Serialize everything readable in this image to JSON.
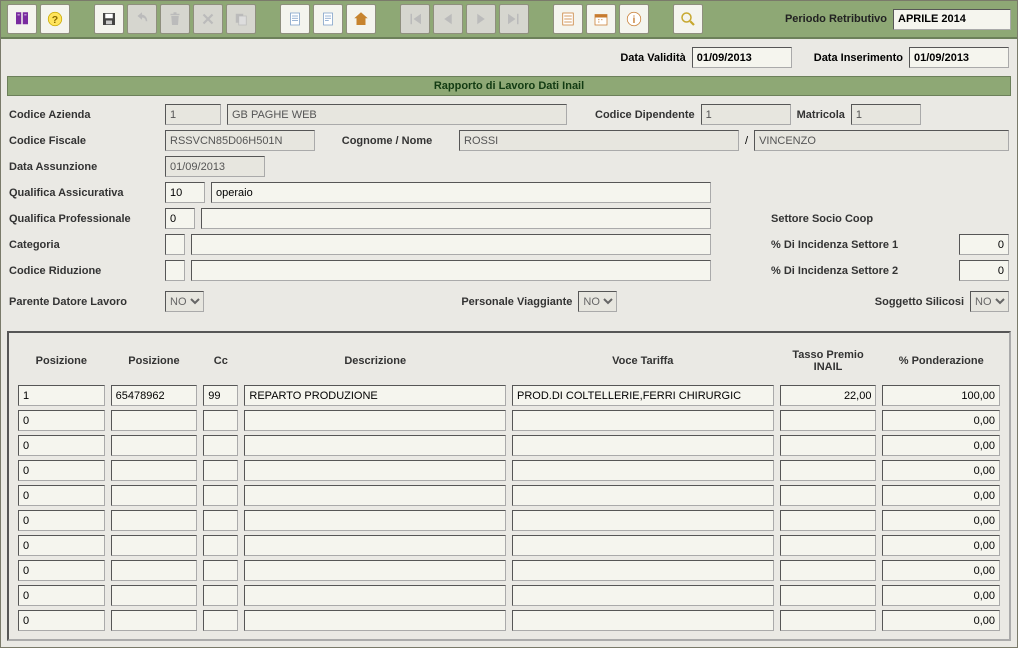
{
  "toolbar": {
    "periodo_label": "Periodo Retributivo",
    "periodo_value": "APRILE 2014",
    "icons": [
      {
        "name": "book-icon",
        "alt": "manual",
        "fill": "#7a2ca0"
      },
      {
        "name": "help-icon",
        "alt": "help",
        "fill": "#e6c100"
      },
      {
        "name": "save-icon",
        "alt": "save",
        "fill": "#333",
        "spacer_before": true
      },
      {
        "name": "undo-icon",
        "alt": "undo",
        "fill": "#999",
        "disabled": true
      },
      {
        "name": "trash-icon",
        "alt": "delete",
        "fill": "#999",
        "disabled": true
      },
      {
        "name": "cancel-icon",
        "alt": "cancel",
        "fill": "#999",
        "disabled": true
      },
      {
        "name": "copy-icon",
        "alt": "copy",
        "fill": "#999",
        "disabled": true
      },
      {
        "name": "doc-icon",
        "alt": "document",
        "fill": "#7a9cc6",
        "spacer_before": true
      },
      {
        "name": "doc2-icon",
        "alt": "document",
        "fill": "#7a9cc6"
      },
      {
        "name": "home-icon",
        "alt": "home",
        "fill": "#c7842f"
      },
      {
        "name": "first-icon",
        "alt": "first",
        "fill": "#999",
        "disabled": true,
        "spacer_before": true
      },
      {
        "name": "prev-icon",
        "alt": "prev",
        "fill": "#999",
        "disabled": true
      },
      {
        "name": "next-icon",
        "alt": "next",
        "fill": "#999",
        "disabled": true
      },
      {
        "name": "last-icon",
        "alt": "last",
        "fill": "#999",
        "disabled": true
      },
      {
        "name": "list-icon",
        "alt": "list",
        "fill": "#c77b2f",
        "spacer_before": true
      },
      {
        "name": "calendar-icon",
        "alt": "calendar",
        "fill": "#c77b2f"
      },
      {
        "name": "info-icon",
        "alt": "info",
        "fill": "#c77b2f"
      },
      {
        "name": "search-icon",
        "alt": "search",
        "fill": "#c7a82f",
        "spacer_before": true
      }
    ]
  },
  "validity": {
    "data_validita_label": "Data Validità",
    "data_validita": "01/09/2013",
    "data_inserimento_label": "Data Inserimento",
    "data_inserimento": "01/09/2013"
  },
  "section": {
    "title": "Rapporto di Lavoro Dati Inail"
  },
  "header": {
    "codice_azienda_label": "Codice Azienda",
    "codice_azienda": "1",
    "azienda_desc": "GB PAGHE WEB",
    "codice_dipendente_label": "Codice Dipendente",
    "codice_dipendente": "1",
    "matricola_label": "Matricola",
    "matricola": "1",
    "codice_fiscale_label": "Codice Fiscale",
    "codice_fiscale": "RSSVCN85D06H501N",
    "cognome_nome_label": "Cognome / Nome",
    "cognome": "ROSSI",
    "nome": "VINCENZO",
    "slash": "/",
    "data_assunzione_label": "Data Assunzione",
    "data_assunzione": "01/09/2013",
    "qual_assic_label": "Qualifica Assicurativa",
    "qual_assic_code": "10",
    "qual_assic_desc": "operaio",
    "qual_prof_label": "Qualifica Professionale",
    "qual_prof_code": "0",
    "qual_prof_desc": "",
    "settore_coop_label": "Settore Socio Coop",
    "categoria_label": "Categoria",
    "categoria_code": "",
    "categoria_desc": "",
    "incidenza1_label": "% Di Incidenza Settore 1",
    "incidenza1": "0",
    "codice_riduzione_label": "Codice Riduzione",
    "codice_riduzione_code": "",
    "codice_riduzione_desc": "",
    "incidenza2_label": "% Di Incidenza Settore 2",
    "incidenza2": "0",
    "parente_label": "Parente Datore Lavoro",
    "parente_value": "NO",
    "viaggiante_label": "Personale Viaggiante",
    "viaggiante_value": "NO",
    "silicosi_label": "Soggetto Silicosi",
    "silicosi_value": "NO"
  },
  "grid": {
    "headers": {
      "pos1": "Posizione",
      "pos2": "Posizione",
      "cc": "Cc",
      "desc": "Descrizione",
      "voce": "Voce Tariffa",
      "tasso": "Tasso Premio INAIL",
      "pond": "% Ponderazione"
    },
    "rows": [
      {
        "pos1": "1",
        "pos2": "65478962",
        "cc": "99",
        "desc": "REPARTO PRODUZIONE",
        "voce": "PROD.DI COLTELLERIE,FERRI CHIRURGIC",
        "tasso": "22,00",
        "pond": "100,00"
      },
      {
        "pos1": "0",
        "pos2": "",
        "cc": "",
        "desc": "",
        "voce": "",
        "tasso": "",
        "pond": "0,00"
      },
      {
        "pos1": "0",
        "pos2": "",
        "cc": "",
        "desc": "",
        "voce": "",
        "tasso": "",
        "pond": "0,00"
      },
      {
        "pos1": "0",
        "pos2": "",
        "cc": "",
        "desc": "",
        "voce": "",
        "tasso": "",
        "pond": "0,00"
      },
      {
        "pos1": "0",
        "pos2": "",
        "cc": "",
        "desc": "",
        "voce": "",
        "tasso": "",
        "pond": "0,00"
      },
      {
        "pos1": "0",
        "pos2": "",
        "cc": "",
        "desc": "",
        "voce": "",
        "tasso": "",
        "pond": "0,00"
      },
      {
        "pos1": "0",
        "pos2": "",
        "cc": "",
        "desc": "",
        "voce": "",
        "tasso": "",
        "pond": "0,00"
      },
      {
        "pos1": "0",
        "pos2": "",
        "cc": "",
        "desc": "",
        "voce": "",
        "tasso": "",
        "pond": "0,00"
      },
      {
        "pos1": "0",
        "pos2": "",
        "cc": "",
        "desc": "",
        "voce": "",
        "tasso": "",
        "pond": "0,00"
      },
      {
        "pos1": "0",
        "pos2": "",
        "cc": "",
        "desc": "",
        "voce": "",
        "tasso": "",
        "pond": "0,00"
      }
    ]
  }
}
